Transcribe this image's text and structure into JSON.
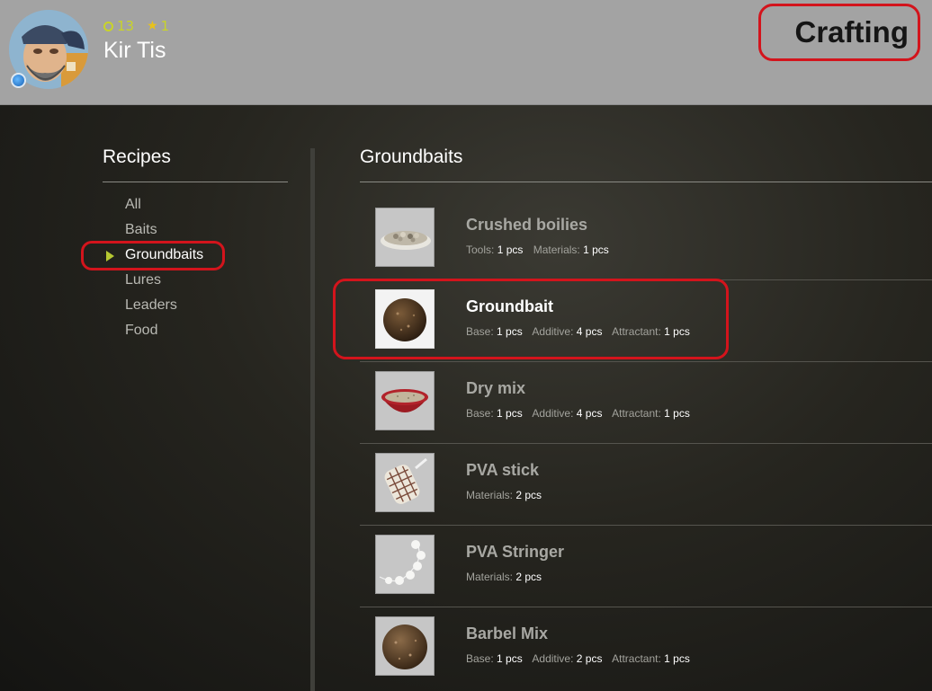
{
  "player": {
    "name": "Kir Tis",
    "currency": "13",
    "rank": "1"
  },
  "page": {
    "title": "Crafting"
  },
  "sidebar": {
    "title": "Recipes",
    "items": [
      {
        "label": "All",
        "active": false
      },
      {
        "label": "Baits",
        "active": false
      },
      {
        "label": "Groundbaits",
        "active": true
      },
      {
        "label": "Lures",
        "active": false
      },
      {
        "label": "Leaders",
        "active": false
      },
      {
        "label": "Food",
        "active": false
      }
    ]
  },
  "content": {
    "title": "Groundbaits",
    "recipes": [
      {
        "name": "Crushed boilies",
        "selected": false,
        "icon": "crushed-boilies-icon",
        "reqs": [
          {
            "k": "Tools:",
            "v": "1 pcs"
          },
          {
            "k": "Materials:",
            "v": "1 pcs"
          }
        ]
      },
      {
        "name": "Groundbait",
        "selected": true,
        "icon": "groundbait-ball-icon",
        "reqs": [
          {
            "k": "Base:",
            "v": "1 pcs"
          },
          {
            "k": "Additive:",
            "v": "4 pcs"
          },
          {
            "k": "Attractant:",
            "v": "1 pcs"
          }
        ]
      },
      {
        "name": "Dry mix",
        "selected": false,
        "icon": "dry-mix-bowl-icon",
        "reqs": [
          {
            "k": "Base:",
            "v": "1 pcs"
          },
          {
            "k": "Additive:",
            "v": "4 pcs"
          },
          {
            "k": "Attractant:",
            "v": "1 pcs"
          }
        ]
      },
      {
        "name": "PVA stick",
        "selected": false,
        "icon": "pva-stick-icon",
        "reqs": [
          {
            "k": "Materials:",
            "v": "2 pcs"
          }
        ]
      },
      {
        "name": "PVA Stringer",
        "selected": false,
        "icon": "pva-stringer-icon",
        "reqs": [
          {
            "k": "Materials:",
            "v": "2 pcs"
          }
        ]
      },
      {
        "name": "Barbel Mix",
        "selected": false,
        "icon": "barbel-mix-ball-icon",
        "reqs": [
          {
            "k": "Base:",
            "v": "1 pcs"
          },
          {
            "k": "Additive:",
            "v": "2 pcs"
          },
          {
            "k": "Attractant:",
            "v": "1 pcs"
          }
        ]
      }
    ]
  },
  "colors": {
    "highlight": "#d3141c",
    "accent": "#b6c832",
    "header_bg": "#a3a3a3"
  }
}
